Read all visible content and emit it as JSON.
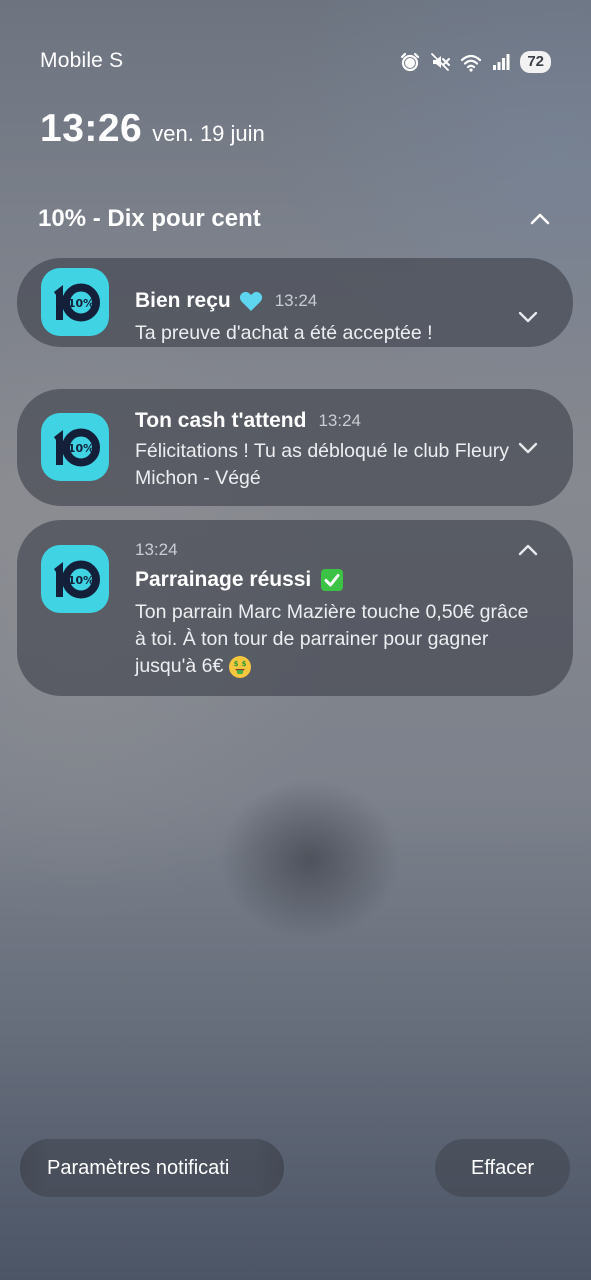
{
  "status_bar": {
    "carrier": "Mobile S",
    "icons": [
      "alarm-icon",
      "mute-icon",
      "wifi-icon",
      "signal-icon"
    ],
    "battery": "72"
  },
  "lock": {
    "time": "13:26",
    "date": "ven. 19 juin"
  },
  "group": {
    "title": "10% - Dix pour cent",
    "expanded": true
  },
  "notifications": [
    {
      "title": "Bien reçu",
      "emoji": "light-blue-heart-icon",
      "time": "13:24",
      "body": "Ta preuve d'achat a été acceptée !",
      "expanded": false
    },
    {
      "title": "Ton cash t'attend",
      "time": "13:24",
      "body": "Félicitations ! Tu as débloqué le club Fleury Michon - Végé",
      "expanded": false
    },
    {
      "title": "Parrainage réussi",
      "emoji": "check-mark-button-icon",
      "time": "13:24",
      "body": "Ton parrain Marc Mazière touche 0,50€ grâce à toi. À ton tour de parrainer pour gagner jusqu'à 6€",
      "body_emoji": "money-mouth-face-icon",
      "expanded": true
    }
  ],
  "app": {
    "icon_label": "10%",
    "accent": "#3fd3e3",
    "icon_ink": "#14203a"
  },
  "buttons": {
    "settings": "Paramètres notificati",
    "clear": "Effacer"
  }
}
